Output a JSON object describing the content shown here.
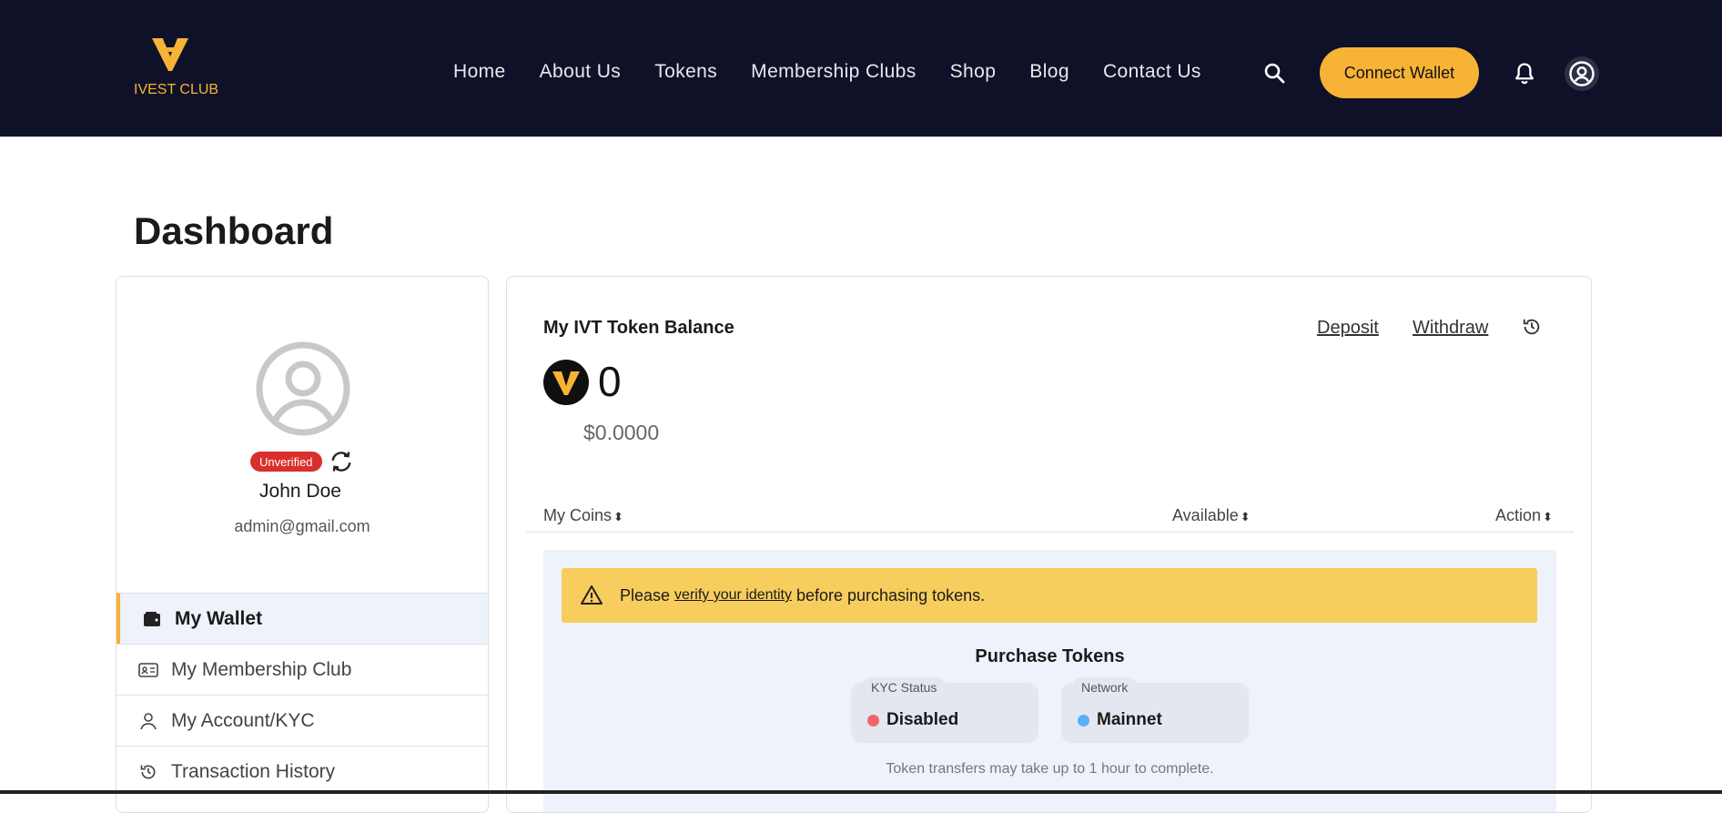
{
  "header": {
    "logo_text": "IVEST CLUB",
    "nav": [
      "Home",
      "About Us",
      "Tokens",
      "Membership Clubs",
      "Shop",
      "Blog",
      "Contact Us"
    ],
    "connect_wallet": "Connect Wallet",
    "accent_color": "#f7b335",
    "bg_color": "#0f1128"
  },
  "page": {
    "title": "Dashboard"
  },
  "profile": {
    "status_badge": "Unverified",
    "name": "John Doe",
    "email": "admin@gmail.com"
  },
  "sidebar": {
    "items": [
      {
        "label": "My Wallet",
        "icon": "wallet-icon",
        "active": true
      },
      {
        "label": "My Membership Club",
        "icon": "id-card-icon",
        "active": false
      },
      {
        "label": "My Account/KYC",
        "icon": "user-icon",
        "active": false
      },
      {
        "label": "Transaction History",
        "icon": "history-icon",
        "active": false
      }
    ]
  },
  "wallet": {
    "title": "My IVT Token Balance",
    "deposit": "Deposit",
    "withdraw": "Withdraw",
    "balance": "0",
    "usd_value": "$0.0000",
    "table": {
      "columns": [
        "My Coins",
        "Available",
        "Action"
      ],
      "sort_glyph": "⬍"
    },
    "alert": {
      "prefix": "Please",
      "link": "verify your identity",
      "suffix": "before purchasing tokens."
    },
    "purchase": {
      "title": "Purchase Tokens",
      "kyc_label": "KYC Status",
      "kyc_value": "Disabled",
      "kyc_color": "#f0666b",
      "network_label": "Network",
      "network_value": "Mainnet",
      "network_color": "#5ab0f5",
      "note": "Token transfers may take up to 1 hour to complete."
    }
  }
}
